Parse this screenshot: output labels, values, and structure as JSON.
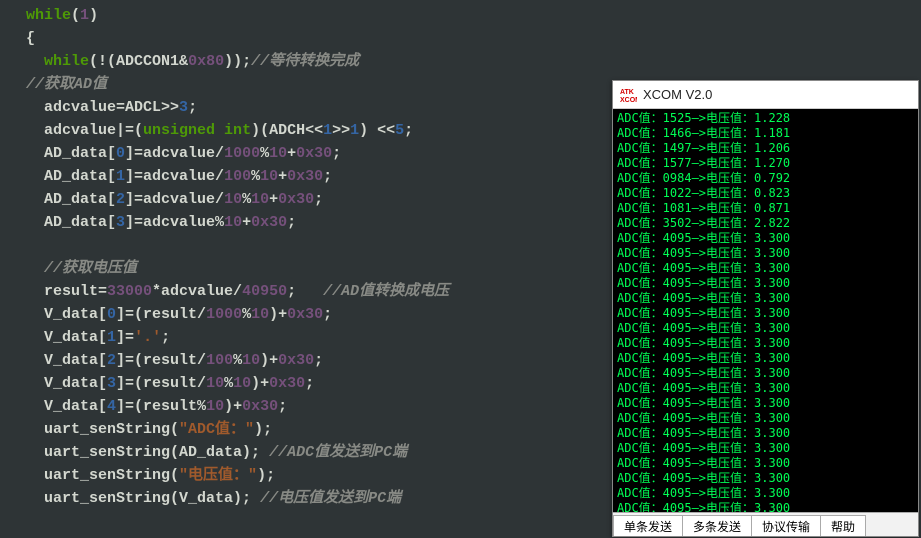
{
  "code": {
    "lines": [
      {
        "indent": 1,
        "tokens": [
          {
            "t": "while",
            "c": "kw"
          },
          {
            "t": "(",
            "c": "plain"
          },
          {
            "t": "1",
            "c": "num"
          },
          {
            "t": ")",
            "c": "plain"
          }
        ]
      },
      {
        "indent": 1,
        "tokens": [
          {
            "t": "{",
            "c": "plain"
          }
        ]
      },
      {
        "indent": 2,
        "tokens": [
          {
            "t": "while",
            "c": "kw"
          },
          {
            "t": "(!(ADCCON1&",
            "c": "plain"
          },
          {
            "t": "0x80",
            "c": "num"
          },
          {
            "t": "));",
            "c": "plain"
          },
          {
            "t": "//等待转换完成",
            "c": "cmt"
          }
        ]
      },
      {
        "indent": 1,
        "tokens": [
          {
            "t": "//获取AD值",
            "c": "cmt"
          }
        ]
      },
      {
        "indent": 2,
        "tokens": [
          {
            "t": "adcvalue=ADCL>>",
            "c": "plain"
          },
          {
            "t": "3",
            "c": "num2"
          },
          {
            "t": ";",
            "c": "plain"
          }
        ]
      },
      {
        "indent": 2,
        "tokens": [
          {
            "t": "adcvalue|=(",
            "c": "plain"
          },
          {
            "t": "unsigned int",
            "c": "kw"
          },
          {
            "t": ")(ADCH<<",
            "c": "plain"
          },
          {
            "t": "1",
            "c": "num2"
          },
          {
            "t": ">>",
            "c": "plain"
          },
          {
            "t": "1",
            "c": "num2"
          },
          {
            "t": ") <<",
            "c": "plain"
          },
          {
            "t": "5",
            "c": "num2"
          },
          {
            "t": ";",
            "c": "plain"
          }
        ]
      },
      {
        "indent": 2,
        "tokens": [
          {
            "t": "AD_data[",
            "c": "plain"
          },
          {
            "t": "0",
            "c": "num2"
          },
          {
            "t": "]=adcvalue/",
            "c": "plain"
          },
          {
            "t": "1000",
            "c": "num"
          },
          {
            "t": "%",
            "c": "plain"
          },
          {
            "t": "10",
            "c": "num"
          },
          {
            "t": "+",
            "c": "plain"
          },
          {
            "t": "0x30",
            "c": "num"
          },
          {
            "t": ";",
            "c": "plain"
          }
        ]
      },
      {
        "indent": 2,
        "tokens": [
          {
            "t": "AD_data[",
            "c": "plain"
          },
          {
            "t": "1",
            "c": "num2"
          },
          {
            "t": "]=adcvalue/",
            "c": "plain"
          },
          {
            "t": "100",
            "c": "num"
          },
          {
            "t": "%",
            "c": "plain"
          },
          {
            "t": "10",
            "c": "num"
          },
          {
            "t": "+",
            "c": "plain"
          },
          {
            "t": "0x30",
            "c": "num"
          },
          {
            "t": ";",
            "c": "plain"
          }
        ]
      },
      {
        "indent": 2,
        "tokens": [
          {
            "t": "AD_data[",
            "c": "plain"
          },
          {
            "t": "2",
            "c": "num2"
          },
          {
            "t": "]=adcvalue/",
            "c": "plain"
          },
          {
            "t": "10",
            "c": "num"
          },
          {
            "t": "%",
            "c": "plain"
          },
          {
            "t": "10",
            "c": "num"
          },
          {
            "t": "+",
            "c": "plain"
          },
          {
            "t": "0x30",
            "c": "num"
          },
          {
            "t": ";",
            "c": "plain"
          }
        ]
      },
      {
        "indent": 2,
        "tokens": [
          {
            "t": "AD_data[",
            "c": "plain"
          },
          {
            "t": "3",
            "c": "num2"
          },
          {
            "t": "]=adcvalue%",
            "c": "plain"
          },
          {
            "t": "10",
            "c": "num"
          },
          {
            "t": "+",
            "c": "plain"
          },
          {
            "t": "0x30",
            "c": "num"
          },
          {
            "t": ";",
            "c": "plain"
          }
        ]
      },
      {
        "indent": 0,
        "tokens": [
          {
            "t": " ",
            "c": "plain"
          }
        ]
      },
      {
        "indent": 2,
        "tokens": [
          {
            "t": "//获取电压值",
            "c": "cmt"
          }
        ]
      },
      {
        "indent": 2,
        "tokens": [
          {
            "t": "result=",
            "c": "plain"
          },
          {
            "t": "33000",
            "c": "num"
          },
          {
            "t": "*adcvalue/",
            "c": "plain"
          },
          {
            "t": "40950",
            "c": "num"
          },
          {
            "t": ";   ",
            "c": "plain"
          },
          {
            "t": "//AD值转换成电压",
            "c": "cmt"
          }
        ]
      },
      {
        "indent": 2,
        "tokens": [
          {
            "t": "V_data[",
            "c": "plain"
          },
          {
            "t": "0",
            "c": "num2"
          },
          {
            "t": "]=(result/",
            "c": "plain"
          },
          {
            "t": "1000",
            "c": "num"
          },
          {
            "t": "%",
            "c": "plain"
          },
          {
            "t": "10",
            "c": "num"
          },
          {
            "t": ")+",
            "c": "plain"
          },
          {
            "t": "0x30",
            "c": "num"
          },
          {
            "t": ";",
            "c": "plain"
          }
        ]
      },
      {
        "indent": 2,
        "tokens": [
          {
            "t": "V_data[",
            "c": "plain"
          },
          {
            "t": "1",
            "c": "num2"
          },
          {
            "t": "]=",
            "c": "plain"
          },
          {
            "t": "'.'",
            "c": "str"
          },
          {
            "t": ";",
            "c": "plain"
          }
        ]
      },
      {
        "indent": 2,
        "tokens": [
          {
            "t": "V_data[",
            "c": "plain"
          },
          {
            "t": "2",
            "c": "num2"
          },
          {
            "t": "]=(result/",
            "c": "plain"
          },
          {
            "t": "100",
            "c": "num"
          },
          {
            "t": "%",
            "c": "plain"
          },
          {
            "t": "10",
            "c": "num"
          },
          {
            "t": ")+",
            "c": "plain"
          },
          {
            "t": "0x30",
            "c": "num"
          },
          {
            "t": ";",
            "c": "plain"
          }
        ]
      },
      {
        "indent": 2,
        "tokens": [
          {
            "t": "V_data[",
            "c": "plain"
          },
          {
            "t": "3",
            "c": "num2"
          },
          {
            "t": "]=(result/",
            "c": "plain"
          },
          {
            "t": "10",
            "c": "num"
          },
          {
            "t": "%",
            "c": "plain"
          },
          {
            "t": "10",
            "c": "num"
          },
          {
            "t": ")+",
            "c": "plain"
          },
          {
            "t": "0x30",
            "c": "num"
          },
          {
            "t": ";",
            "c": "plain"
          }
        ]
      },
      {
        "indent": 2,
        "tokens": [
          {
            "t": "V_data[",
            "c": "plain"
          },
          {
            "t": "4",
            "c": "num2"
          },
          {
            "t": "]=(result%",
            "c": "plain"
          },
          {
            "t": "10",
            "c": "num"
          },
          {
            "t": ")+",
            "c": "plain"
          },
          {
            "t": "0x30",
            "c": "num"
          },
          {
            "t": ";",
            "c": "plain"
          }
        ]
      },
      {
        "indent": 2,
        "tokens": [
          {
            "t": "uart_senString(",
            "c": "plain"
          },
          {
            "t": "\"ADC值：\"",
            "c": "str"
          },
          {
            "t": ");",
            "c": "plain"
          }
        ]
      },
      {
        "indent": 2,
        "tokens": [
          {
            "t": "uart_senString(AD_data); ",
            "c": "plain"
          },
          {
            "t": "//ADC值发送到PC端",
            "c": "cmt"
          }
        ]
      },
      {
        "indent": 2,
        "tokens": [
          {
            "t": "uart_senString(",
            "c": "plain"
          },
          {
            "t": "\"电压值：\"",
            "c": "str"
          },
          {
            "t": ");",
            "c": "plain"
          }
        ]
      },
      {
        "indent": 2,
        "tokens": [
          {
            "t": "uart_senString(V_data); ",
            "c": "plain"
          },
          {
            "t": "//电压值发送到PC端",
            "c": "cmt"
          }
        ]
      }
    ],
    "indent_spaces": "  "
  },
  "serial": {
    "title": "XCOM V2.0",
    "rows": [
      {
        "adc": 1525,
        "v": "1.228"
      },
      {
        "adc": 1466,
        "v": "1.181"
      },
      {
        "adc": 1497,
        "v": "1.206"
      },
      {
        "adc": 1577,
        "v": "1.270"
      },
      {
        "adc": "0984",
        "v": "0.792"
      },
      {
        "adc": 1022,
        "v": "0.823"
      },
      {
        "adc": 1081,
        "v": "0.871"
      },
      {
        "adc": 3502,
        "v": "2.822"
      },
      {
        "adc": 4095,
        "v": "3.300"
      },
      {
        "adc": 4095,
        "v": "3.300"
      },
      {
        "adc": 4095,
        "v": "3.300"
      },
      {
        "adc": 4095,
        "v": "3.300"
      },
      {
        "adc": 4095,
        "v": "3.300"
      },
      {
        "adc": 4095,
        "v": "3.300"
      },
      {
        "adc": 4095,
        "v": "3.300"
      },
      {
        "adc": 4095,
        "v": "3.300"
      },
      {
        "adc": 4095,
        "v": "3.300"
      },
      {
        "adc": 4095,
        "v": "3.300"
      },
      {
        "adc": 4095,
        "v": "3.300"
      },
      {
        "adc": 4095,
        "v": "3.300"
      },
      {
        "adc": 4095,
        "v": "3.300"
      },
      {
        "adc": 4095,
        "v": "3.300"
      },
      {
        "adc": 4095,
        "v": "3.300"
      },
      {
        "adc": 4095,
        "v": "3.300"
      },
      {
        "adc": 4095,
        "v": "3.300"
      },
      {
        "adc": 4095,
        "v": "3.300"
      },
      {
        "adc": 4095,
        "v": "3.300"
      }
    ],
    "row_template": {
      "prefix": "ADC值：",
      "mid": "—>电压值：",
      "suffix": ""
    },
    "tabs": [
      "单条发送",
      "多条发送",
      "协议传输",
      "帮助"
    ]
  }
}
